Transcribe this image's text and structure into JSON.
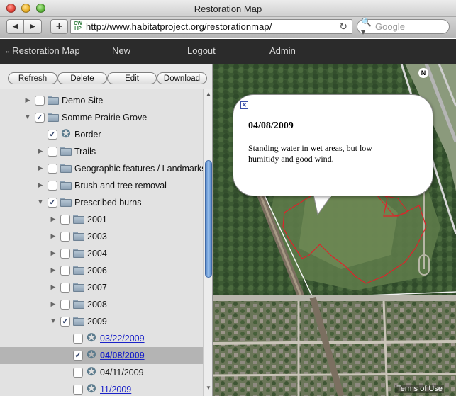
{
  "window": {
    "title": "Restoration Map"
  },
  "browser": {
    "back_icon": "◀",
    "forward_icon": "▶",
    "add_icon": "+",
    "favicon_text": "CW HP",
    "url": "http://www.habitatproject.org/restorationmap/",
    "reload_icon": "↻",
    "search_icon": "🔍▾",
    "search_placeholder": "Google"
  },
  "nav": {
    "restoration_map": "Restoration Map",
    "new": "New",
    "logout": "Logout",
    "admin": "Admin",
    "dots": "••"
  },
  "actions": {
    "refresh": "Refresh",
    "delete": "Delete",
    "edit": "Edit",
    "download": "Download"
  },
  "tree": [
    {
      "label": "Demo Site",
      "level": 0,
      "arrow": "right",
      "checked": false,
      "icon": "folder"
    },
    {
      "label": "Somme Prairie Grove",
      "level": 0,
      "arrow": "down",
      "checked": true,
      "icon": "folder"
    },
    {
      "label": "Border",
      "level": 1,
      "arrow": "none",
      "checked": true,
      "icon": "star"
    },
    {
      "label": "Trails",
      "level": 1,
      "arrow": "right",
      "checked": false,
      "icon": "folder"
    },
    {
      "label": "Geographic features / Landmarks",
      "level": 1,
      "arrow": "right",
      "checked": false,
      "icon": "folder"
    },
    {
      "label": "Brush and tree removal",
      "level": 1,
      "arrow": "right",
      "checked": false,
      "icon": "folder"
    },
    {
      "label": "Prescribed burns",
      "level": 1,
      "arrow": "down",
      "checked": true,
      "icon": "folder"
    },
    {
      "label": "2001",
      "level": 2,
      "arrow": "right",
      "checked": false,
      "icon": "folder"
    },
    {
      "label": "2003",
      "level": 2,
      "arrow": "right",
      "checked": false,
      "icon": "folder"
    },
    {
      "label": "2004",
      "level": 2,
      "arrow": "right",
      "checked": false,
      "icon": "folder"
    },
    {
      "label": "2006",
      "level": 2,
      "arrow": "right",
      "checked": false,
      "icon": "folder"
    },
    {
      "label": "2007",
      "level": 2,
      "arrow": "right",
      "checked": false,
      "icon": "folder"
    },
    {
      "label": "2008",
      "level": 2,
      "arrow": "right",
      "checked": false,
      "icon": "folder"
    },
    {
      "label": "2009",
      "level": 2,
      "arrow": "down",
      "checked": true,
      "icon": "folder"
    },
    {
      "label": "03/22/2009",
      "level": 3,
      "arrow": "none",
      "checked": false,
      "icon": "star",
      "link": true
    },
    {
      "label": "04/08/2009",
      "level": 3,
      "arrow": "none",
      "checked": true,
      "icon": "star",
      "link": true,
      "selected": true
    },
    {
      "label": "04/11/2009",
      "level": 3,
      "arrow": "none",
      "checked": false,
      "icon": "star"
    },
    {
      "label": "11/2009",
      "level": 3,
      "arrow": "none",
      "checked": false,
      "icon": "star",
      "link": true
    }
  ],
  "map": {
    "north_label": "N",
    "terms": "Terms of Use",
    "polygon_color": "#e0222a"
  },
  "popup": {
    "close_icon": "✕",
    "date": "04/08/2009",
    "note": "Standing water in wet areas, but low humitidy and good wind."
  }
}
